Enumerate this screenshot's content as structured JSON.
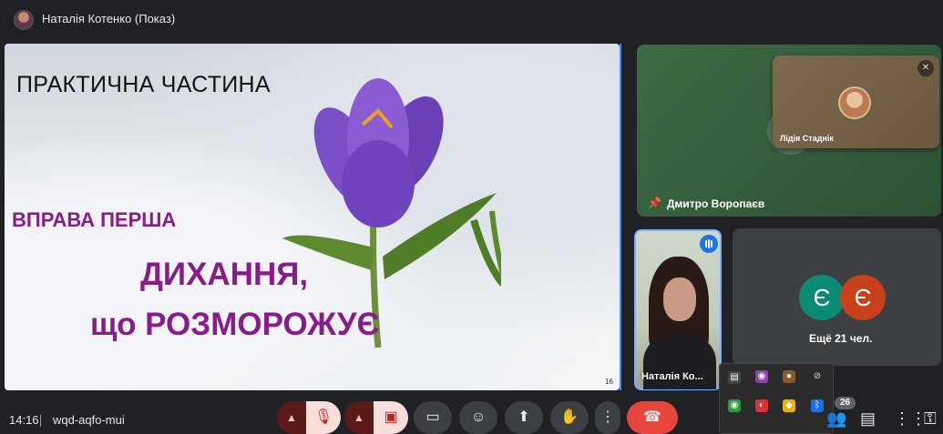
{
  "window": {
    "presenter_title": "Наталія Котенко (Показ)"
  },
  "slide": {
    "heading": "ПРАКТИЧНА ЧАСТИНА",
    "subheading": "ВПРАВА ПЕРША",
    "title_line1": "ДИХАННЯ,",
    "title_line2": "що РОЗМОРОЖУЄ",
    "page_number": "16"
  },
  "participants": {
    "pinned_name": "Дмитро Воропаєв",
    "floating_name": "Лідія Стаднік",
    "self_name": "Наталія Ко...",
    "more_initials": [
      "Є",
      "Є"
    ],
    "more_text": "Ещё 21 чел."
  },
  "meeting": {
    "time": "14:16",
    "code": "wqd-aqfo-mui",
    "participant_count": "26"
  },
  "colors": {
    "accent": "#1a73e8",
    "end_call": "#e8453c",
    "slide_purple": "#8a1b8a",
    "tile_green": "#2b5234"
  },
  "icons": {
    "mic": "mic-off-icon",
    "camera": "camera-off-icon",
    "captions": "captions-icon",
    "emoji": "emoji-icon",
    "present": "present-screen-icon",
    "hand": "raise-hand-icon",
    "more": "more-vert-icon",
    "end": "call-end-icon"
  }
}
